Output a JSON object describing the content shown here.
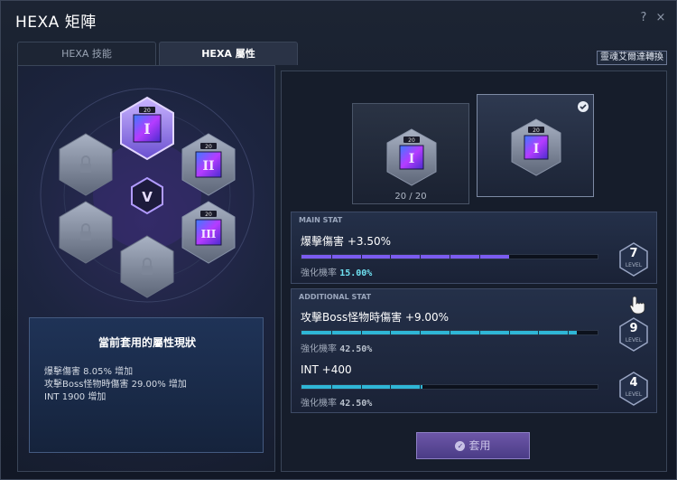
{
  "window": {
    "title": "HEXA 矩陣",
    "help": "?",
    "close": "×"
  },
  "tabs": [
    {
      "label": "HEXA 技能",
      "active": false
    },
    {
      "label": "HEXA 屬性",
      "active": true
    }
  ],
  "convert_button": "靈魂艾爾達轉換",
  "matrix": {
    "center_icon": "v-emblem-icon",
    "nodes": [
      {
        "name": "hexa-stat-node-1",
        "level": "20",
        "roman": "I",
        "selected": true,
        "locked": false
      },
      {
        "name": "hexa-stat-node-2",
        "level": "20",
        "roman": "II",
        "locked": false
      },
      {
        "name": "hexa-stat-node-3",
        "level": "20",
        "roman": "III",
        "locked": false
      },
      {
        "name": "locked-node",
        "locked": true
      }
    ]
  },
  "status": {
    "title": "當前套用的屬性現狀",
    "lines": [
      "爆擊傷害 8.05% 增加",
      "攻擊Boss怪物時傷害 29.00% 增加",
      "INT 1900 增加"
    ]
  },
  "cards": [
    {
      "level": "20",
      "roman": "I",
      "caption": "20 / 20",
      "selected": false
    },
    {
      "level": "20",
      "roman": "I",
      "checked": true,
      "selected": true
    }
  ],
  "main_stat": {
    "header": "MAIN STAT",
    "name": "爆擊傷害 +3.50%",
    "chance_label": "強化機率",
    "chance_value": "15.00%",
    "level": "7",
    "level_label": "LEVEL",
    "progress": 0.7,
    "color": "#7b5cf0"
  },
  "additional_stat": {
    "header": "ADDITIONAL STAT",
    "stats": [
      {
        "name": "攻擊Boss怪物時傷害 +9.00%",
        "chance_label": "強化機率",
        "chance_value": "42.50%",
        "level": "9",
        "level_label": "LEVEL",
        "progress": 0.93,
        "color": "#2fb6d6"
      },
      {
        "name": "INT +400",
        "chance_label": "強化機率",
        "chance_value": "42.50%",
        "level": "4",
        "level_label": "LEVEL",
        "progress": 0.41,
        "color": "#2fb6d6"
      }
    ]
  },
  "apply_button": {
    "label": "套用",
    "icon": "check-circle-icon",
    "enabled": false
  }
}
